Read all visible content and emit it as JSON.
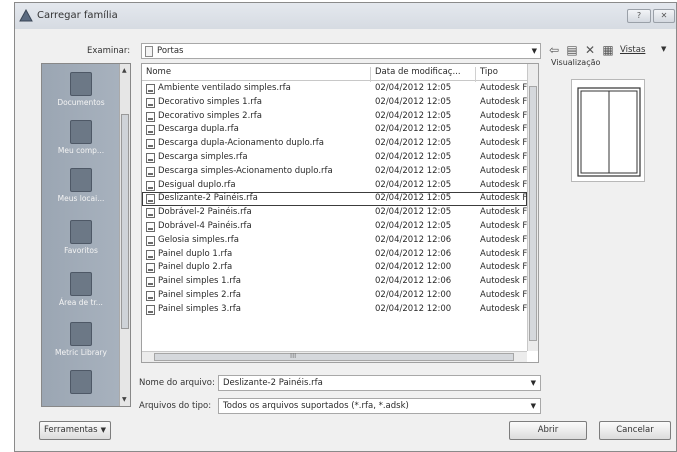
{
  "window": {
    "title": "Carregar família",
    "help_label": "?",
    "close_label": "✕"
  },
  "toolbar": {
    "look_in_label": "Examinar:",
    "look_in_value": "Portas",
    "views_label": "Vistas",
    "preview_label": "Visualização"
  },
  "places": [
    {
      "label": "Documentos"
    },
    {
      "label": "Meu comp..."
    },
    {
      "label": "Meus locai..."
    },
    {
      "label": "Favoritos"
    },
    {
      "label": "Área de tr..."
    },
    {
      "label": "Metric Library"
    },
    {
      "label": ""
    }
  ],
  "file_list": {
    "columns": [
      "Nome",
      "Data de modificaç...",
      "Tipo"
    ],
    "hscroll_label": "III",
    "rows": [
      {
        "name": "Ambiente ventilado simples.rfa",
        "date": "02/04/2012 12:05",
        "type": "Autodesk F"
      },
      {
        "name": "Decorativo simples 1.rfa",
        "date": "02/04/2012 12:05",
        "type": "Autodesk F"
      },
      {
        "name": "Decorativo simples 2.rfa",
        "date": "02/04/2012 12:05",
        "type": "Autodesk F"
      },
      {
        "name": "Descarga dupla.rfa",
        "date": "02/04/2012 12:05",
        "type": "Autodesk F"
      },
      {
        "name": "Descarga dupla-Acionamento duplo.rfa",
        "date": "02/04/2012 12:05",
        "type": "Autodesk F"
      },
      {
        "name": "Descarga simples.rfa",
        "date": "02/04/2012 12:05",
        "type": "Autodesk F"
      },
      {
        "name": "Descarga simples-Acionamento duplo.rfa",
        "date": "02/04/2012 12:05",
        "type": "Autodesk F"
      },
      {
        "name": "Desigual duplo.rfa",
        "date": "02/04/2012 12:05",
        "type": "Autodesk F"
      },
      {
        "name": "Deslizante-2 Painéis.rfa",
        "date": "02/04/2012 12:05",
        "type": "Autodesk F",
        "selected": true
      },
      {
        "name": "Dobrável-2 Painéis.rfa",
        "date": "02/04/2012 12:05",
        "type": "Autodesk F"
      },
      {
        "name": "Dobrável-4 Painéis.rfa",
        "date": "02/04/2012 12:05",
        "type": "Autodesk F"
      },
      {
        "name": "Gelosia simples.rfa",
        "date": "02/04/2012 12:06",
        "type": "Autodesk F"
      },
      {
        "name": "Painel duplo 1.rfa",
        "date": "02/04/2012 12:06",
        "type": "Autodesk F"
      },
      {
        "name": "Painel duplo 2.rfa",
        "date": "02/04/2012 12:00",
        "type": "Autodesk F"
      },
      {
        "name": "Painel simples 1.rfa",
        "date": "02/04/2012 12:06",
        "type": "Autodesk F"
      },
      {
        "name": "Painel simples 2.rfa",
        "date": "02/04/2012 12:00",
        "type": "Autodesk F"
      },
      {
        "name": "Painel simples 3.rfa",
        "date": "02/04/2012 12:00",
        "type": "Autodesk F"
      }
    ]
  },
  "filename": {
    "label": "Nome do arquivo:",
    "value": "Deslizante-2 Painéis.rfa"
  },
  "filetype": {
    "label": "Arquivos do tipo:",
    "value": "Todos os arquivos suportados  (*.rfa, *.adsk)"
  },
  "buttons": {
    "tools": "Ferramentas",
    "open": "Abrir",
    "cancel": "Cancelar"
  }
}
